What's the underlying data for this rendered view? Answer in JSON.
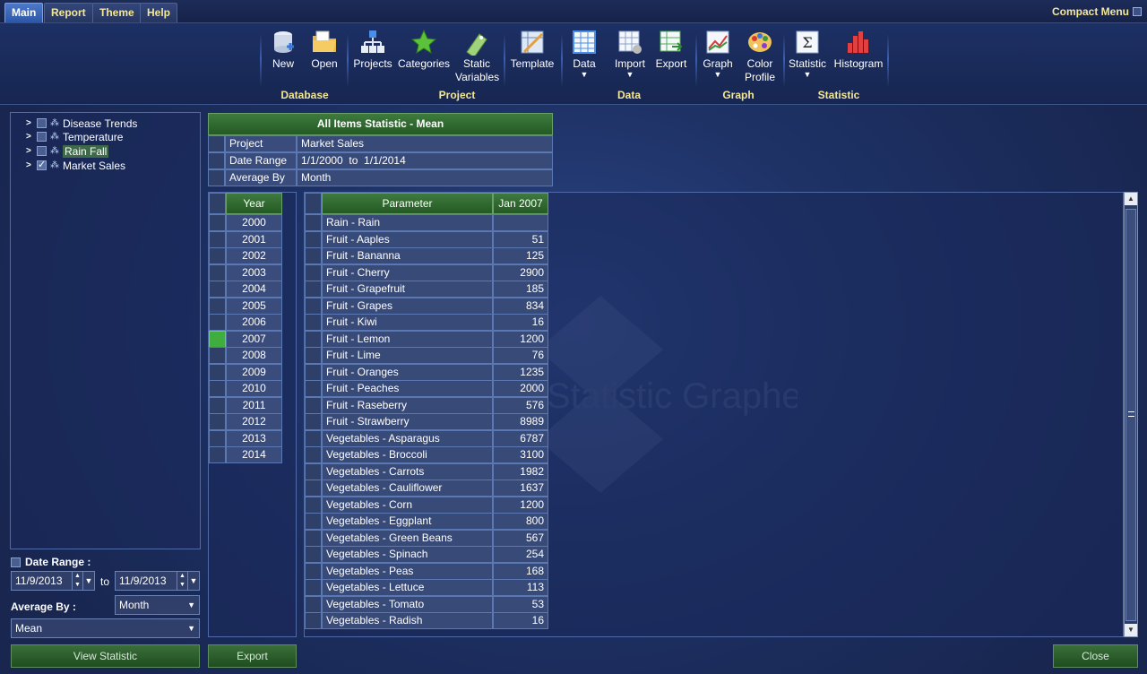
{
  "menubar": {
    "tabs": [
      "Main",
      "Report",
      "Theme",
      "Help"
    ],
    "compact_menu": "Compact Menu"
  },
  "ribbon": {
    "new": "New",
    "open": "Open",
    "projects": "Projects",
    "categories": "Categories",
    "static_variables_1": "Static",
    "static_variables_2": "Variables",
    "template": "Template",
    "data": "Data",
    "import": "Import",
    "export": "Export",
    "graph": "Graph",
    "color_profile_1": "Color",
    "color_profile_2": "Profile",
    "statistic": "Statistic",
    "histogram": "Histogram",
    "groups": {
      "database": "Database",
      "project": "Project",
      "data": "Data",
      "graph": "Graph",
      "statistic": "Statistic"
    }
  },
  "tree": {
    "items": [
      {
        "label": "Disease Trends",
        "checked": false
      },
      {
        "label": "Temperature",
        "checked": false
      },
      {
        "label": "Rain Fall",
        "checked": false
      },
      {
        "label": "Market Sales",
        "checked": true
      }
    ]
  },
  "controls": {
    "date_range_label": "Date Range :",
    "from_date": "11/9/2013",
    "to_label": "to",
    "to_date": "11/9/2013",
    "average_by_label": "Average By :",
    "average_by_value": "Month",
    "mean_value": "Mean",
    "view_statistic": "View Statistic",
    "export": "Export",
    "close": "Close"
  },
  "info": {
    "title": "All Items Statistic - Mean",
    "rows": [
      {
        "key": "Project",
        "value": "Market Sales"
      },
      {
        "key": "Date Range",
        "value": "1/1/2000  to  1/1/2014"
      },
      {
        "key": "Average By",
        "value": "Month"
      }
    ]
  },
  "years": {
    "header": "Year",
    "selected": "2007",
    "values": [
      "2000",
      "2001",
      "2002",
      "2003",
      "2004",
      "2005",
      "2006",
      "2007",
      "2008",
      "2009",
      "2010",
      "2011",
      "2012",
      "2013",
      "2014"
    ]
  },
  "table": {
    "headers": [
      "Parameter",
      "Jan 2007"
    ],
    "rows": [
      [
        "Rain - Rain",
        ""
      ],
      [
        "Fruit - Aaples",
        "51"
      ],
      [
        "Fruit - Bananna",
        "125"
      ],
      [
        "Fruit - Cherry",
        "2900"
      ],
      [
        "Fruit - Grapefruit",
        "185"
      ],
      [
        "Fruit - Grapes",
        "834"
      ],
      [
        "Fruit - Kiwi",
        "16"
      ],
      [
        "Fruit - Lemon",
        "1200"
      ],
      [
        "Fruit - Lime",
        "76"
      ],
      [
        "Fruit - Oranges",
        "1235"
      ],
      [
        "Fruit - Peaches",
        "2000"
      ],
      [
        "Fruit - Raseberry",
        "576"
      ],
      [
        "Fruit - Strawberry",
        "8989"
      ],
      [
        "Vegetables - Asparagus",
        "6787"
      ],
      [
        "Vegetables - Broccoli",
        "3100"
      ],
      [
        "Vegetables - Carrots",
        "1982"
      ],
      [
        "Vegetables - Cauliflower",
        "1637"
      ],
      [
        "Vegetables - Corn",
        "1200"
      ],
      [
        "Vegetables - Eggplant",
        "800"
      ],
      [
        "Vegetables - Green Beans",
        "567"
      ],
      [
        "Vegetables - Spinach",
        "254"
      ],
      [
        "Vegetables - Peas",
        "168"
      ],
      [
        "Vegetables - Lettuce",
        "113"
      ],
      [
        "Vegetables - Tomato",
        "53"
      ],
      [
        "Vegetables - Radish",
        "16"
      ]
    ]
  },
  "watermark": "Statistic Grapher",
  "colors": {
    "accent_green": "#2f6e2f",
    "tab_active": "#3b67b8",
    "gold_text": "#f3e79a"
  }
}
